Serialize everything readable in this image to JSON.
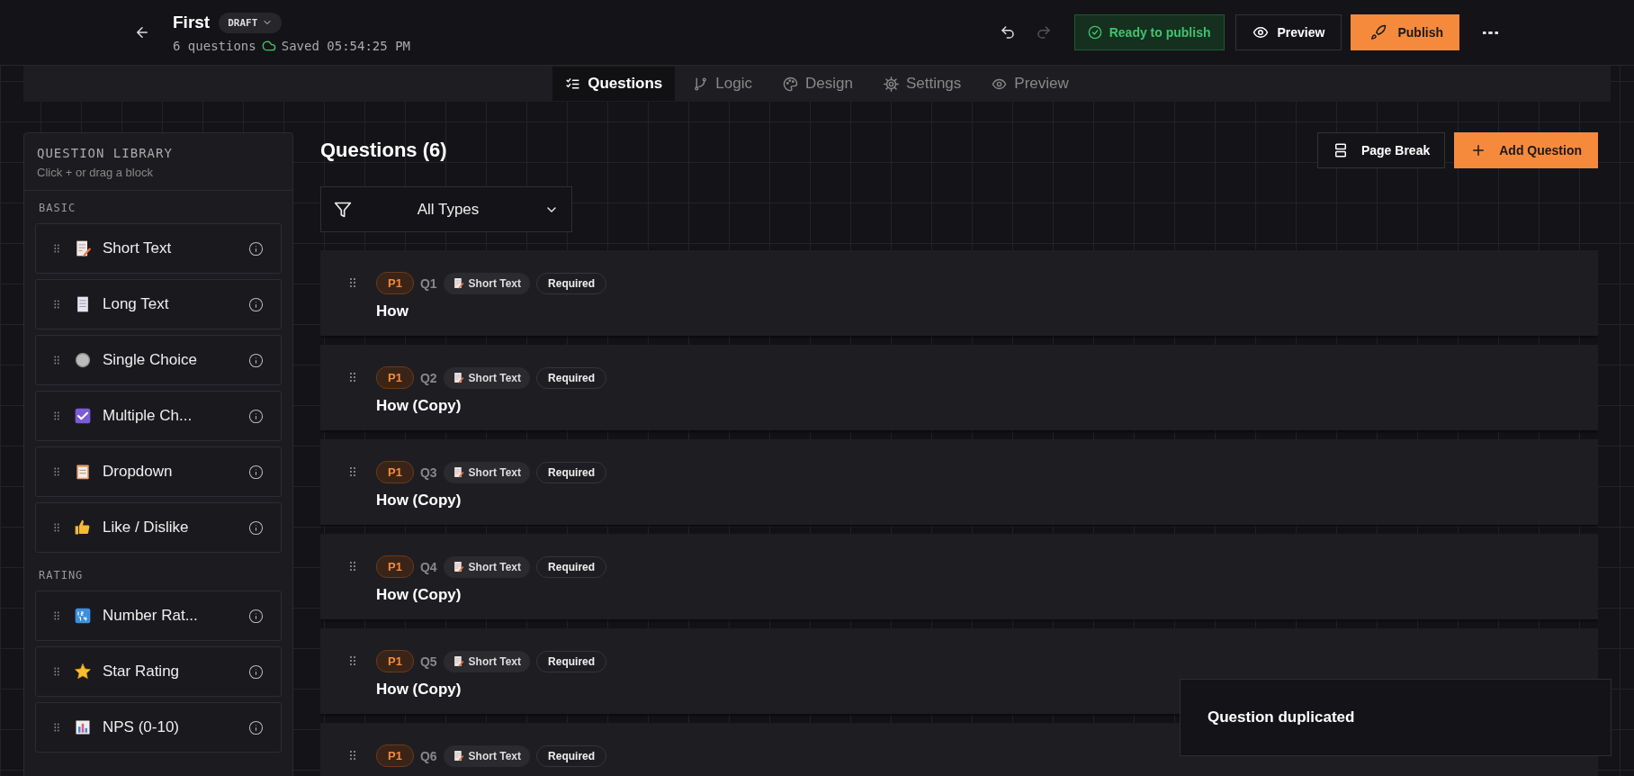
{
  "header": {
    "title": "First",
    "status_badge": "DRAFT",
    "question_count": "6 questions",
    "saved": "Saved 05:54:25 PM",
    "undo_disabled": false,
    "redo_disabled": true,
    "ready": "Ready to publish",
    "preview": "Preview",
    "publish": "Publish"
  },
  "tabs": [
    {
      "label": "Questions",
      "kind": "questions",
      "selected": true
    },
    {
      "label": "Logic",
      "kind": "logic",
      "selected": false
    },
    {
      "label": "Design",
      "kind": "design",
      "selected": false
    },
    {
      "label": "Settings",
      "kind": "settings",
      "selected": false
    },
    {
      "label": "Preview",
      "kind": "preview",
      "selected": false
    }
  ],
  "library": {
    "title": "QUESTION LIBRARY",
    "hint": "Click + or drag a block",
    "sections": [
      {
        "title": "BASIC",
        "items": [
          {
            "label": "Short Text",
            "kind": "short_text"
          },
          {
            "label": "Long Text",
            "kind": "long_text"
          },
          {
            "label": "Single Choice",
            "kind": "single_choice"
          },
          {
            "label": "Multiple Ch...",
            "kind": "multiple_choice"
          },
          {
            "label": "Dropdown",
            "kind": "dropdown"
          },
          {
            "label": "Like / Dislike",
            "kind": "like"
          }
        ]
      },
      {
        "title": "RATING",
        "items": [
          {
            "label": "Number Rat...",
            "kind": "number"
          },
          {
            "label": "Star Rating",
            "kind": "star"
          },
          {
            "label": "NPS (0-10)",
            "kind": "nps"
          }
        ]
      }
    ]
  },
  "main": {
    "heading": "Questions (6)",
    "page_break": "Page Break",
    "add_question": "Add Question",
    "filter": "All Types",
    "questions": [
      {
        "page": "P1",
        "number": "Q1",
        "type": "Short Text",
        "kind": "short_text",
        "required": "Required",
        "title": "How"
      },
      {
        "page": "P1",
        "number": "Q2",
        "type": "Short Text",
        "kind": "short_text",
        "required": "Required",
        "title": "How (Copy)"
      },
      {
        "page": "P1",
        "number": "Q3",
        "type": "Short Text",
        "kind": "short_text",
        "required": "Required",
        "title": "How (Copy)"
      },
      {
        "page": "P1",
        "number": "Q4",
        "type": "Short Text",
        "kind": "short_text",
        "required": "Required",
        "title": "How (Copy)"
      },
      {
        "page": "P1",
        "number": "Q5",
        "type": "Short Text",
        "kind": "short_text",
        "required": "Required",
        "title": "How (Copy)"
      },
      {
        "page": "P1",
        "number": "Q6",
        "type": "Short Text",
        "kind": "short_text",
        "required": "Required"
      }
    ]
  },
  "toast": {
    "message": "Question duplicated"
  }
}
